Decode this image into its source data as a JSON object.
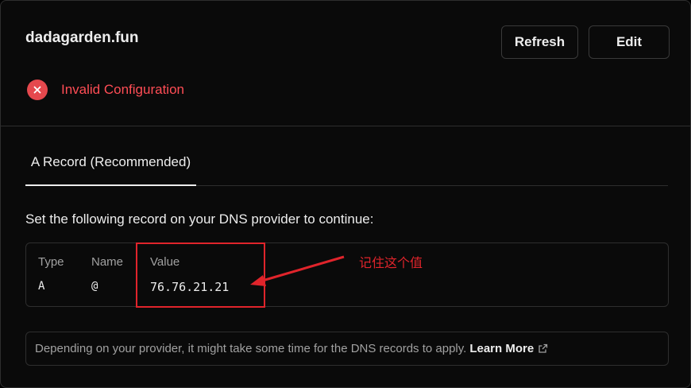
{
  "domain": "dadagarden.fun",
  "buttons": {
    "refresh": "Refresh",
    "edit": "Edit"
  },
  "status": {
    "text": "Invalid Configuration",
    "icon": "x-circle-icon",
    "color": "#e5484d"
  },
  "tabs": [
    {
      "label": "A Record (Recommended)",
      "active": true
    }
  ],
  "instruction": "Set the following record on your DNS provider to continue:",
  "record": {
    "headers": [
      "Type",
      "Name",
      "Value"
    ],
    "values": [
      "A",
      "@",
      "76.76.21.21"
    ]
  },
  "annotation": {
    "text": "记住这个值",
    "color": "#e0242b"
  },
  "note": {
    "text": "Depending on your provider, it might take some time for the DNS records to apply.",
    "link": "Learn More",
    "link_icon": "external-link-icon"
  }
}
